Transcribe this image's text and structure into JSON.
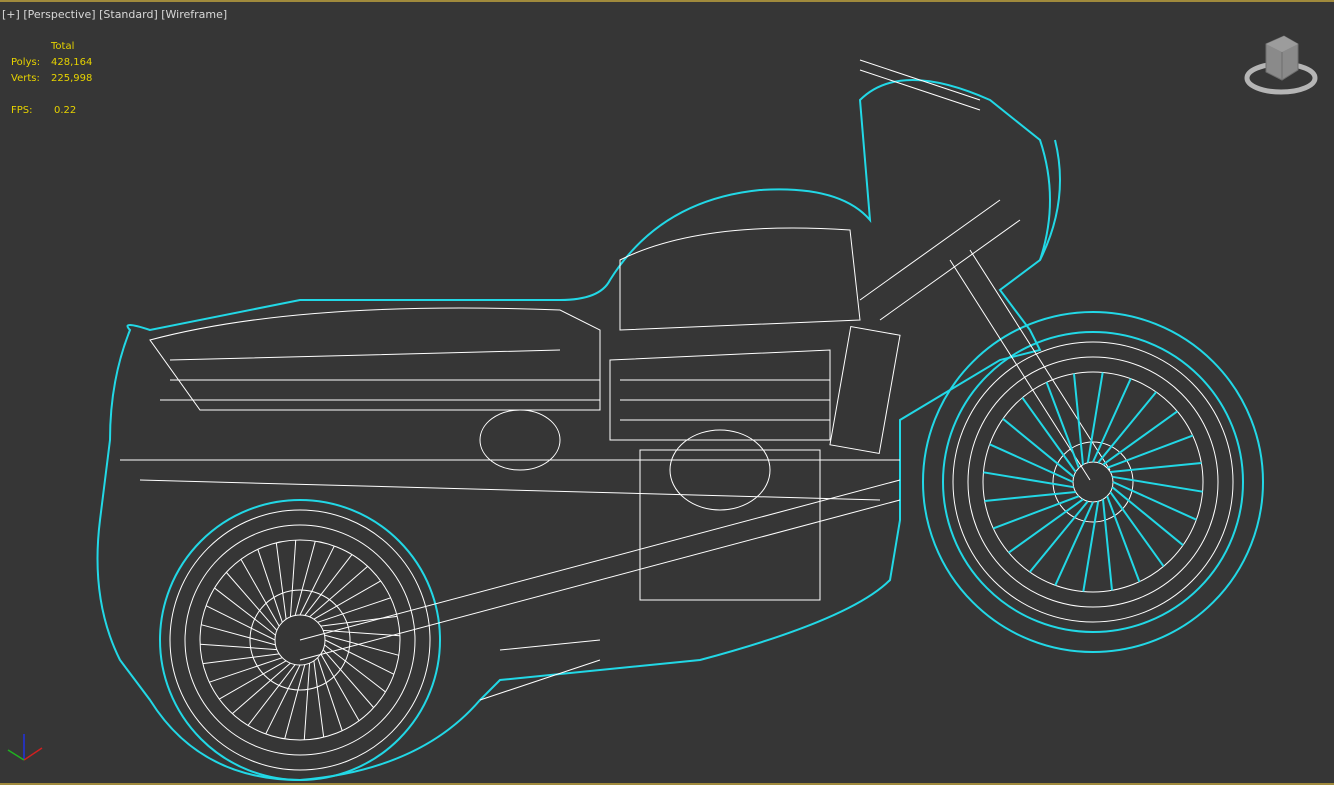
{
  "viewport": {
    "labels": [
      "[+]",
      "[Perspective]",
      "[Standard]",
      "[Wireframe]"
    ]
  },
  "stats": {
    "header": "Total",
    "polys_label": "Polys:",
    "polys_value": "428,164",
    "verts_label": "Verts:",
    "verts_value": "225,998",
    "fps_label": "FPS:",
    "fps_value": "0.22"
  },
  "colors": {
    "background": "#363636",
    "wire": "#ffffff",
    "selection": "#22d8e6",
    "stats": "#e6d200",
    "frame": "#a08a3c"
  }
}
